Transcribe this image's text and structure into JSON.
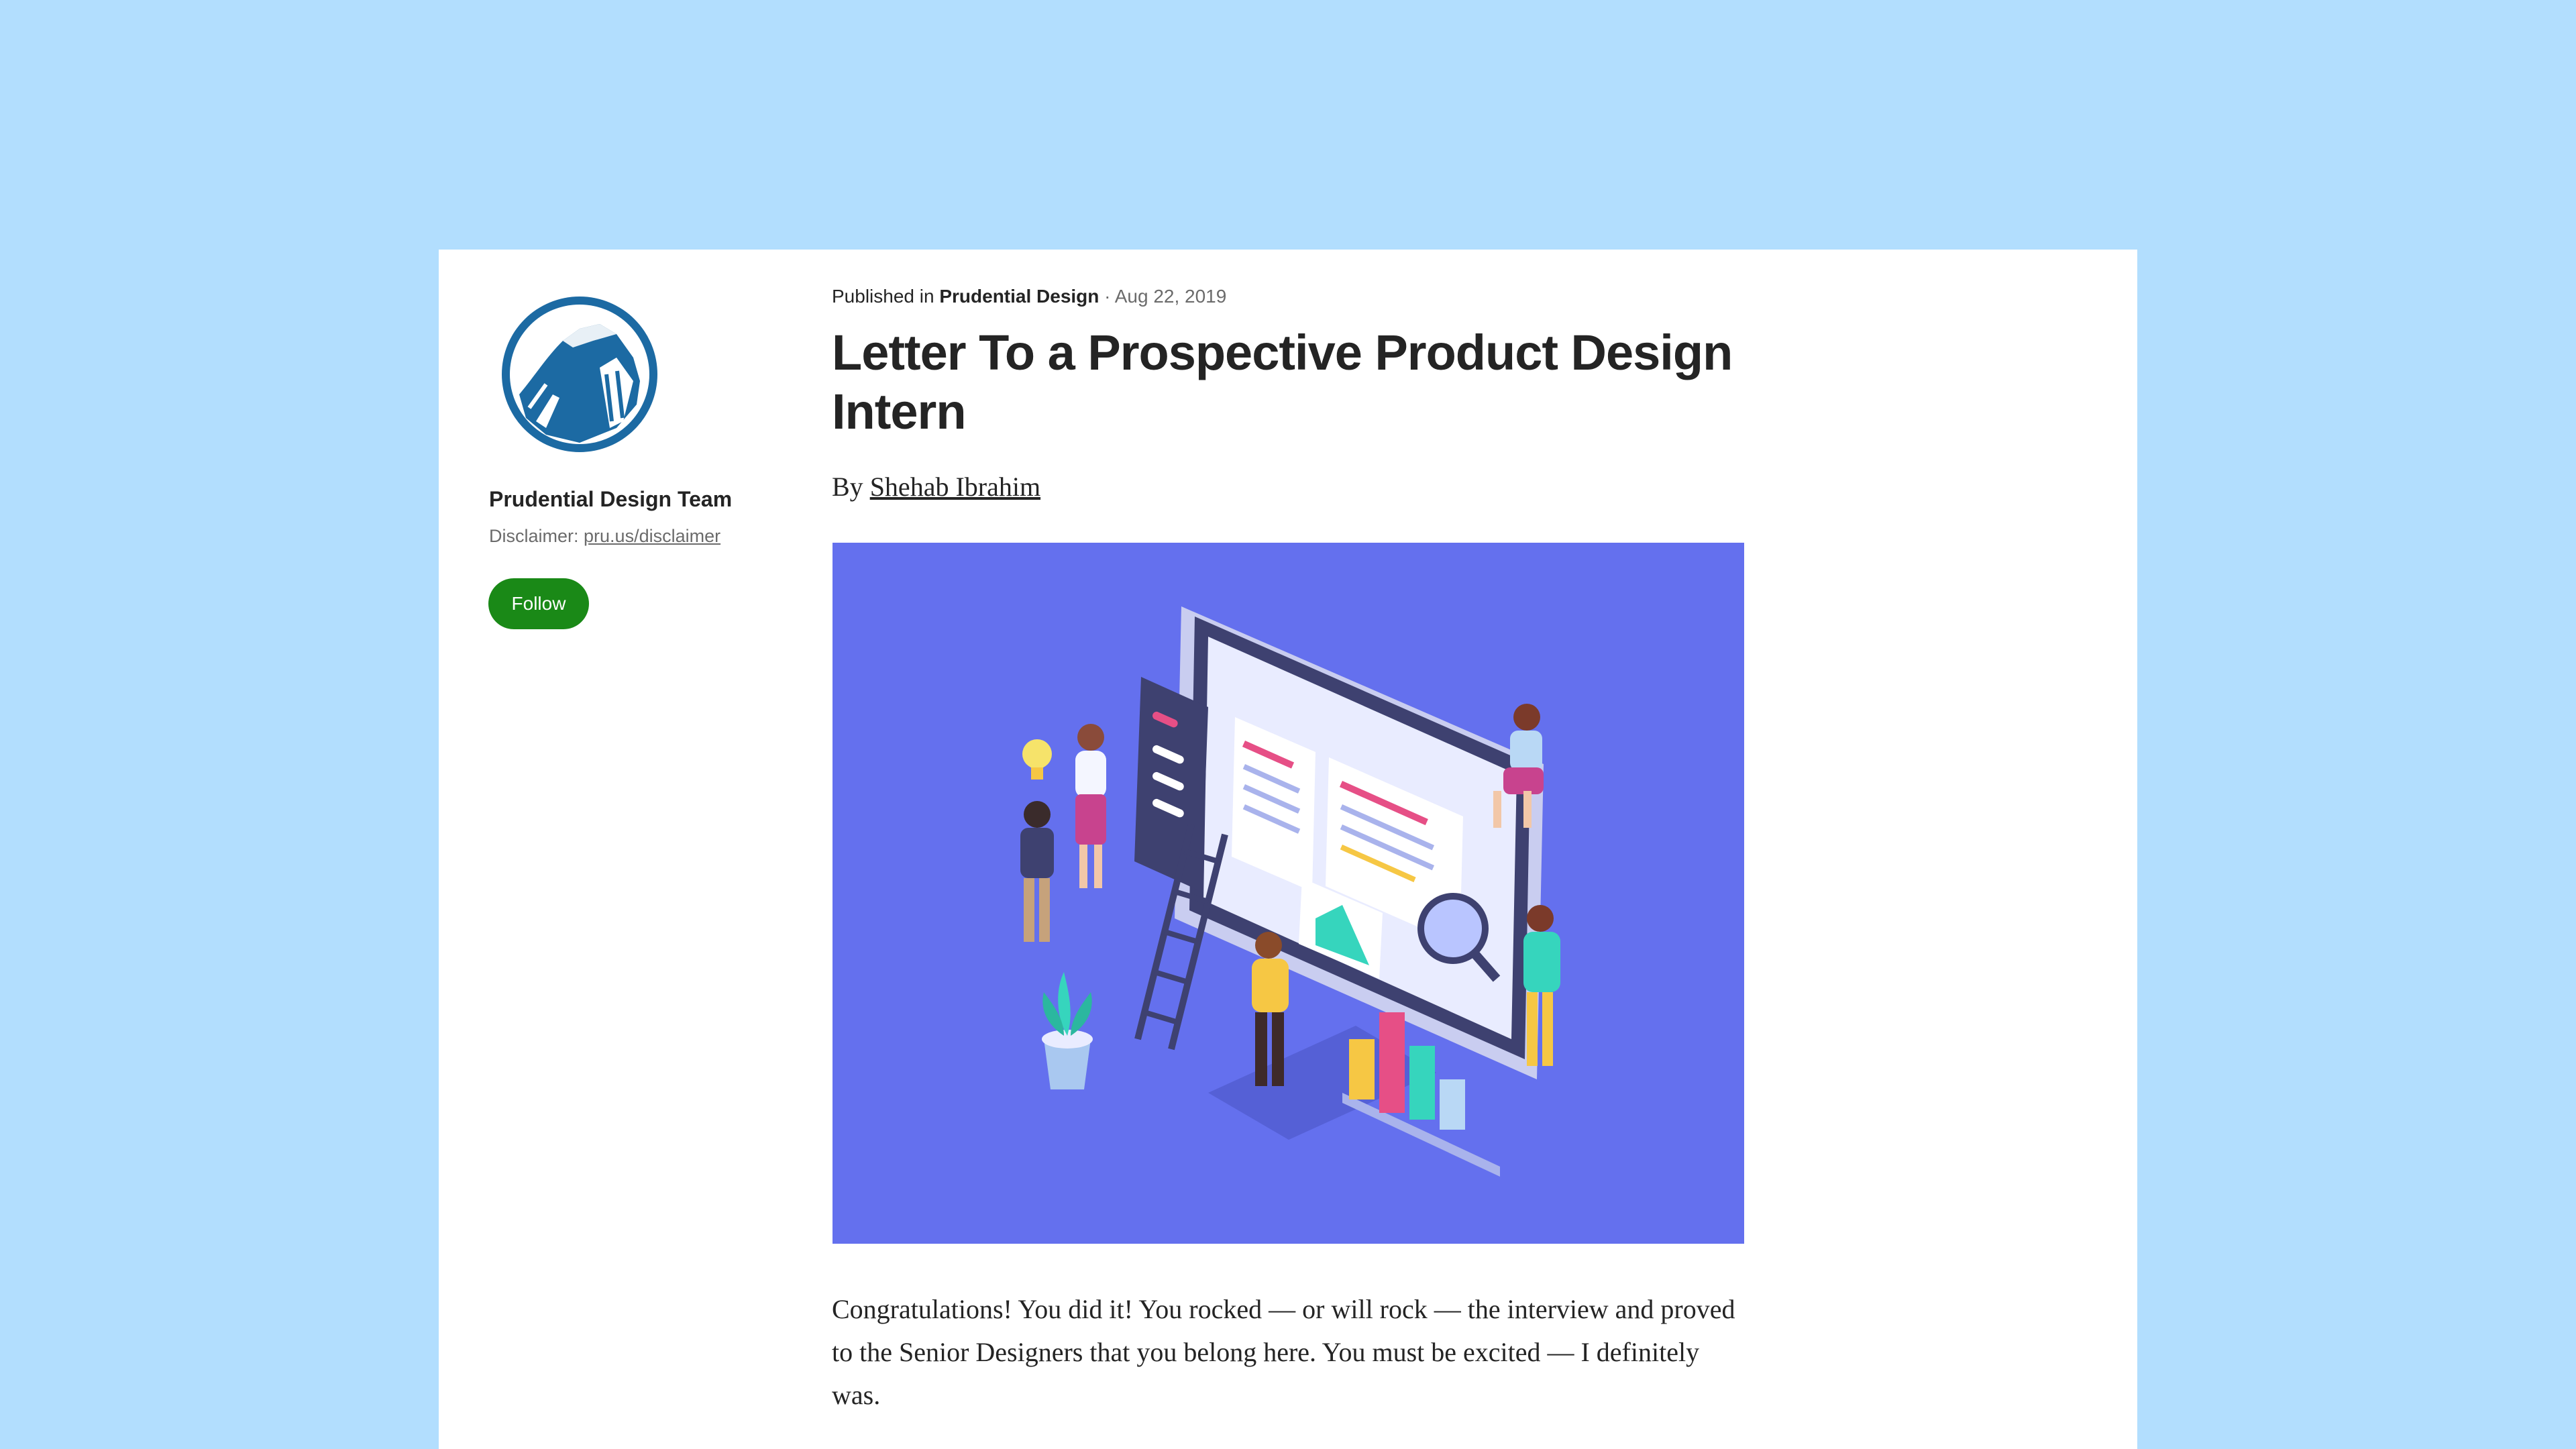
{
  "sidebar": {
    "publication_name": "Prudential Design Team",
    "disclaimer_label": "Disclaimer:",
    "disclaimer_link": "pru.us/disclaimer",
    "follow_label": "Follow"
  },
  "article": {
    "published_prefix": "Published in",
    "publication": "Prudential Design",
    "separator": "·",
    "date": "Aug 22, 2019",
    "title": "Letter To a Prospective Product Design Intern",
    "by_prefix": "By",
    "author": "Shehab Ibrahim",
    "paragraph": "Congratulations! You did it! You rocked — or will rock — the interview and proved to the Senior Designers that you belong here. You must be excited — I definitely was."
  },
  "colors": {
    "page_background": "#b2defe",
    "card_background": "#ffffff",
    "follow_button": "#1a8917",
    "logo_blue": "#1c6aa3",
    "hero_background": "#6470ee"
  },
  "icons": {
    "logo": "prudential-rock-logo-icon"
  }
}
